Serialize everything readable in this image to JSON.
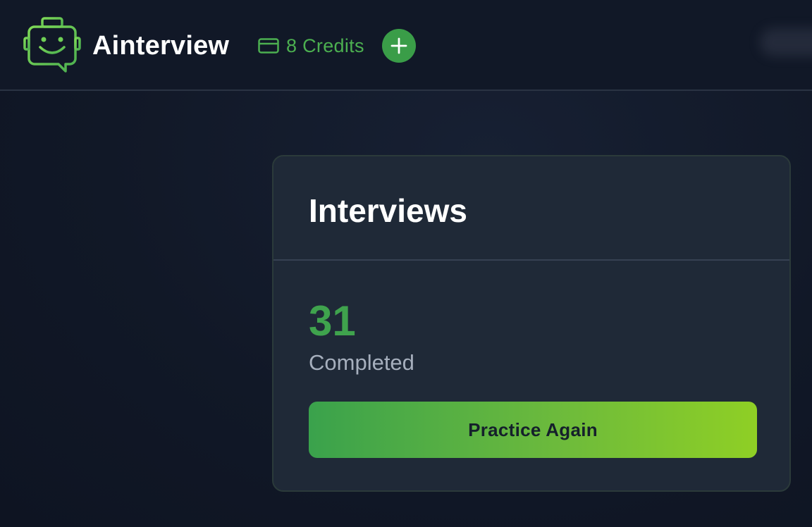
{
  "header": {
    "brand": "Ainterview",
    "logo_icon": "robot-chat-logo",
    "credits": {
      "icon": "credit-card-icon",
      "text": "8 Credits"
    },
    "add_credits_icon": "plus-icon"
  },
  "colors": {
    "background": "#111827",
    "card": "#1f2937",
    "accent": "#3fa34d",
    "button_gradient_start": "#3aa24c",
    "button_gradient_end": "#8fcf25"
  },
  "card": {
    "title": "Interviews",
    "count": "31",
    "count_label": "Completed",
    "button_label": "Practice Again"
  }
}
